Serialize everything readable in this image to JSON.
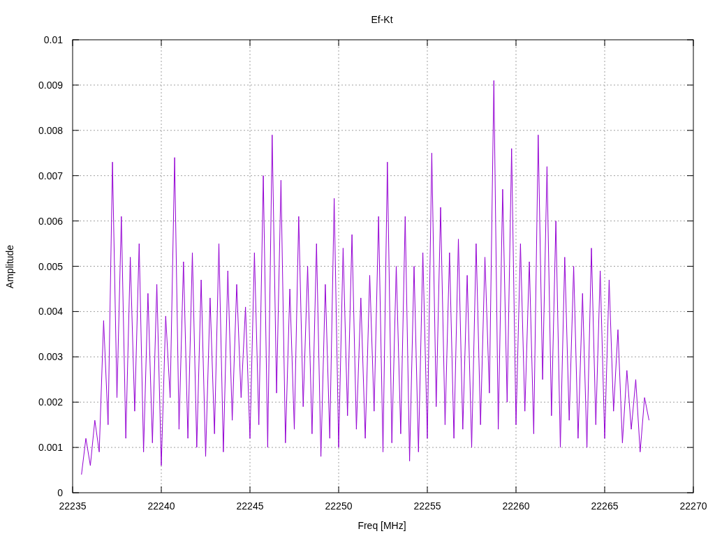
{
  "chart_data": {
    "type": "line",
    "title": "Ef-Kt",
    "xlabel": "Freq [MHz]",
    "ylabel": "Amplitude",
    "xlim": [
      22235,
      22270
    ],
    "ylim": [
      0,
      0.01
    ],
    "grid": true,
    "xticks": [
      22235,
      22240,
      22245,
      22250,
      22255,
      22260,
      22265,
      22270
    ],
    "yticks": [
      0,
      0.001,
      0.002,
      0.003,
      0.004,
      0.005,
      0.006,
      0.007,
      0.008,
      0.009,
      0.01
    ],
    "x": [
      22235.5,
      22235.75,
      22236,
      22236.25,
      22236.5,
      22236.75,
      22237,
      22237.25,
      22237.5,
      22237.75,
      22238,
      22238.25,
      22238.5,
      22238.75,
      22239,
      22239.25,
      22239.5,
      22239.75,
      22240,
      22240.25,
      22240.5,
      22240.75,
      22241,
      22241.25,
      22241.5,
      22241.75,
      22242,
      22242.25,
      22242.5,
      22242.75,
      22243,
      22243.25,
      22243.5,
      22243.75,
      22244,
      22244.25,
      22244.5,
      22244.75,
      22245,
      22245.25,
      22245.5,
      22245.75,
      22246,
      22246.25,
      22246.5,
      22246.75,
      22247,
      22247.25,
      22247.5,
      22247.75,
      22248,
      22248.25,
      22248.5,
      22248.75,
      22249,
      22249.25,
      22249.5,
      22249.75,
      22250,
      22250.25,
      22250.5,
      22250.75,
      22251,
      22251.25,
      22251.5,
      22251.75,
      22252,
      22252.25,
      22252.5,
      22252.75,
      22253,
      22253.25,
      22253.5,
      22253.75,
      22254,
      22254.25,
      22254.5,
      22254.75,
      22255,
      22255.25,
      22255.5,
      22255.75,
      22256,
      22256.25,
      22256.5,
      22256.75,
      22257,
      22257.25,
      22257.5,
      22257.75,
      22258,
      22258.25,
      22258.5,
      22258.75,
      22259,
      22259.25,
      22259.5,
      22259.75,
      22260,
      22260.25,
      22260.5,
      22260.75,
      22261,
      22261.25,
      22261.5,
      22261.75,
      22262,
      22262.25,
      22262.5,
      22262.75,
      22263,
      22263.25,
      22263.5,
      22263.75,
      22264,
      22264.25,
      22264.5,
      22264.75,
      22265,
      22265.25,
      22265.5,
      22265.75,
      22266,
      22266.25,
      22266.5,
      22266.75,
      22267,
      22267.25,
      22267.5
    ],
    "series": [
      {
        "color": "#9400d3",
        "values": [
          0.0004,
          0.0012,
          0.0006,
          0.0016,
          0.0009,
          0.0038,
          0.0015,
          0.0073,
          0.0021,
          0.0061,
          0.0012,
          0.0052,
          0.0018,
          0.0055,
          0.0009,
          0.0044,
          0.0011,
          0.0046,
          0.0006,
          0.0039,
          0.0021,
          0.0074,
          0.0014,
          0.0051,
          0.0012,
          0.0053,
          0.001,
          0.0047,
          0.0008,
          0.0043,
          0.0013,
          0.0055,
          0.0009,
          0.0049,
          0.0016,
          0.0046,
          0.0021,
          0.0041,
          0.0012,
          0.0053,
          0.0015,
          0.007,
          0.001,
          0.0079,
          0.0022,
          0.0069,
          0.0011,
          0.0045,
          0.0014,
          0.0061,
          0.0019,
          0.005,
          0.0013,
          0.0055,
          0.0008,
          0.0046,
          0.0012,
          0.0065,
          0.001,
          0.0054,
          0.0017,
          0.0057,
          0.0014,
          0.0043,
          0.0012,
          0.0048,
          0.0018,
          0.0061,
          0.0009,
          0.0073,
          0.0011,
          0.005,
          0.0013,
          0.0061,
          0.0007,
          0.005,
          0.0009,
          0.0053,
          0.0012,
          0.0075,
          0.0019,
          0.0063,
          0.0015,
          0.0053,
          0.0012,
          0.0056,
          0.0014,
          0.0048,
          0.001,
          0.0055,
          0.0015,
          0.0052,
          0.0022,
          0.0091,
          0.0014,
          0.0067,
          0.002,
          0.0076,
          0.0015,
          0.0055,
          0.0018,
          0.0051,
          0.0013,
          0.0079,
          0.0025,
          0.0072,
          0.0017,
          0.006,
          0.001,
          0.0052,
          0.0016,
          0.005,
          0.0012,
          0.0044,
          0.001,
          0.0054,
          0.0015,
          0.0049,
          0.0012,
          0.0047,
          0.0018,
          0.0036,
          0.0011,
          0.0027,
          0.0014,
          0.0025,
          0.0009,
          0.0021,
          0.0016
        ]
      }
    ]
  }
}
